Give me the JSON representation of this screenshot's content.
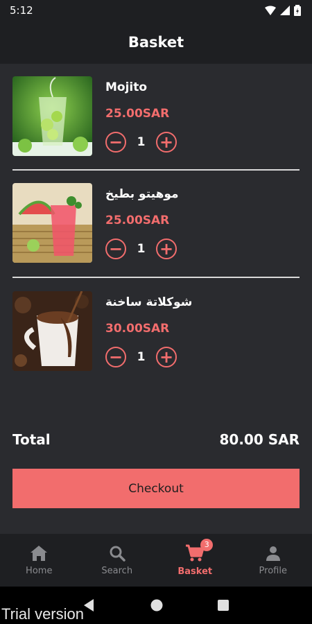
{
  "status_bar": {
    "time": "5:12",
    "icons": [
      "wifi-icon",
      "signal-icon",
      "battery-icon"
    ]
  },
  "header": {
    "title": "Basket"
  },
  "basket": {
    "items": [
      {
        "name": "Mojito",
        "price": "25.00SAR",
        "quantity": "1",
        "image": "mojito-drink-photo"
      },
      {
        "name": "موهيتو بطيخ",
        "price": "25.00SAR",
        "quantity": "1",
        "image": "watermelon-mojito-photo"
      },
      {
        "name": "شوكلاتة ساخنة",
        "price": "30.00SAR",
        "quantity": "1",
        "image": "hot-chocolate-photo"
      }
    ],
    "decrease_symbol": "−",
    "increase_symbol": "+"
  },
  "summary": {
    "total_label": "Total",
    "total_value": "80.00 SAR"
  },
  "checkout": {
    "label": "Checkout"
  },
  "bottom_nav": {
    "items": [
      {
        "label": "Home",
        "icon": "home-icon"
      },
      {
        "label": "Search",
        "icon": "search-icon"
      },
      {
        "label": "Basket",
        "icon": "cart-icon",
        "badge": "3",
        "active": true
      },
      {
        "label": "Profile",
        "icon": "person-icon"
      }
    ]
  },
  "system_nav": {
    "icons": [
      "back-icon",
      "home-circle-icon",
      "recents-icon"
    ]
  },
  "watermark": "Trial version",
  "colors": {
    "accent": "#f26d6d",
    "background": "#2a2b2f",
    "bar": "#1e1f22"
  }
}
